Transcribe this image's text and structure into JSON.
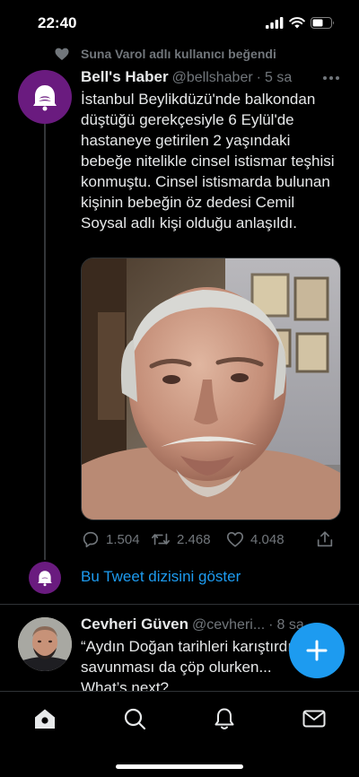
{
  "status_bar": {
    "time": "22:40"
  },
  "social_context": {
    "text": "Suna Varol adlı kullanıcı beğendi"
  },
  "tweet": {
    "name": "Bell's Haber",
    "handle": "@bellshaber",
    "separator": "·",
    "time": "5 sa",
    "text": "İstanbul Beylikdüzü'nde balkondan düştüğü gerekçesiyle 6 Eylül'de hastaneye getirilen 2 yaşındaki bebeğe nitelikle cinsel istismar teşhisi konmuştu. Cinsel istismarda bulunan kişinin bebeğin öz dedesi Cemil Soysal adlı kişi olduğu anlaşıldı.",
    "replies": "1.504",
    "retweets": "2.468",
    "likes": "4.048"
  },
  "show_thread": {
    "label": "Bu Tweet dizisini göster"
  },
  "tweet2": {
    "name": "Cevheri Güven",
    "handle": "@cevheri...",
    "separator": "·",
    "time": "8 sa",
    "text": "“Aydın Doğan tarihleri karıştırdı savunması da çöp olurken... What’s next?"
  },
  "colors": {
    "accent": "#1d9bf0",
    "brand_avatar": "#6a1b7f",
    "muted": "#71767b"
  },
  "icons": {
    "tabs": [
      "home-icon",
      "search-icon",
      "notifications-icon",
      "messages-icon"
    ],
    "actions": [
      "reply-icon",
      "retweet-icon",
      "like-icon",
      "share-icon"
    ],
    "fab": "compose-plus-icon"
  }
}
